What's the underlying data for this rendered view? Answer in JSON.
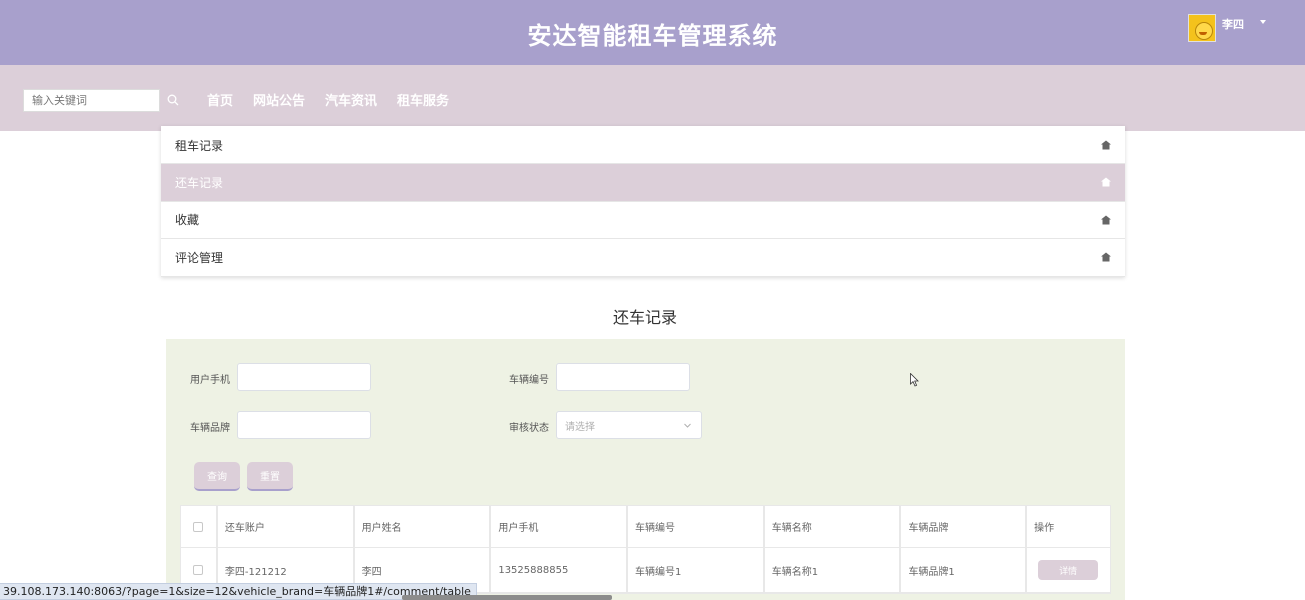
{
  "header": {
    "title": "安达智能租车管理系统",
    "user_name": "李四"
  },
  "nav": {
    "search_placeholder": "输入关键词",
    "links": [
      "首页",
      "网站公告",
      "汽车资讯",
      "租车服务"
    ]
  },
  "menu": {
    "items": [
      "租车记录",
      "还车记录",
      "收藏",
      "评论管理"
    ],
    "active_index": 1
  },
  "section_title": "还车记录",
  "filters": {
    "phone_label": "用户手机",
    "vehicle_no_label": "车辆编号",
    "brand_label": "车辆品牌",
    "audit_label": "审核状态",
    "audit_placeholder": "请选择",
    "query_button": "查询",
    "reset_button": "重置"
  },
  "table": {
    "columns": [
      "还车账户",
      "用户姓名",
      "用户手机",
      "车辆编号",
      "车辆名称",
      "车辆品牌",
      "操作"
    ],
    "rows": [
      {
        "account": "李四-121212",
        "name": "李四",
        "phone": "13525888855",
        "vehicle_no": "车辆编号1",
        "vehicle_name": "车辆名称1",
        "brand": "车辆品牌1",
        "action": "详情"
      }
    ]
  },
  "status_bar": {
    "url": "39.108.173.140:8063/?page=1&size=12&vehicle_brand=车辆品牌1#/comment/table"
  },
  "colors": {
    "header_bg": "#a8a0cc",
    "nav_bg": "#dccfd9",
    "filter_bg": "#eef2e4"
  }
}
